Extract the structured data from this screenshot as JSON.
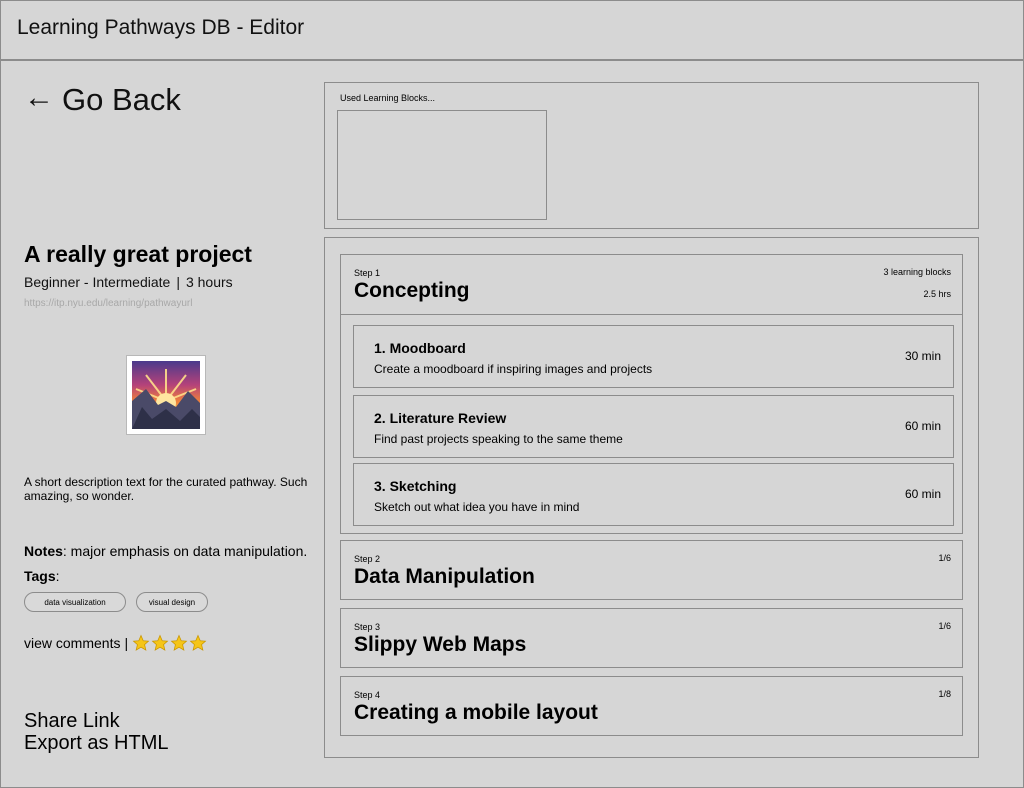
{
  "window": {
    "title": "Learning Pathways DB - Editor"
  },
  "nav": {
    "go_back_arrow": "←",
    "go_back_label": "Go Back"
  },
  "project": {
    "title": "A really great project",
    "level": "Beginner - Intermediate",
    "separator": "|",
    "duration": "3 hours",
    "url": "https://itp.nyu.edu/learning/pathwayurl",
    "thumbnail_icon": "sunrise-over-mountains-icon",
    "description": "A short description text for the curated pathway. Such amazing, so wonder.",
    "notes_label": "Notes",
    "notes_text": ": major emphasis on data manipulation.",
    "tags_label": "Tags",
    "tags_colon": ":",
    "tags": [
      "data visualization",
      "visual design"
    ],
    "comments_label": "view comments",
    "comments_sep": "|",
    "rating": 4
  },
  "actions": {
    "share": "Share Link",
    "export": "Export as HTML"
  },
  "used_blocks": {
    "label": "Used Learning Blocks..."
  },
  "steps": [
    {
      "num": "Step 1",
      "name": "Concepting",
      "blocks_count": "3 learning blocks",
      "hours": "2.5 hrs",
      "blocks": [
        {
          "title": "1. Moodboard",
          "desc": "Create a moodboard if inspiring images and projects",
          "time": "30 min"
        },
        {
          "title": "2. Literature Review",
          "desc": "Find past projects speaking to the same theme",
          "time": "60 min"
        },
        {
          "title": "3. Sketching",
          "desc": "Sketch out what idea you have in mind",
          "time": "60 min"
        }
      ]
    },
    {
      "num": "Step 2",
      "name": "Data Manipulation",
      "progress": "1/6"
    },
    {
      "num": "Step 3",
      "name": "Slippy Web Maps",
      "progress": "1/6"
    },
    {
      "num": "Step 4",
      "name": "Creating a mobile layout",
      "progress": "1/8"
    }
  ],
  "colors": {
    "background": "#d6d6d6",
    "border": "#8c8c8c",
    "url_text": "#a8a8a8",
    "star": "#f5c518"
  }
}
